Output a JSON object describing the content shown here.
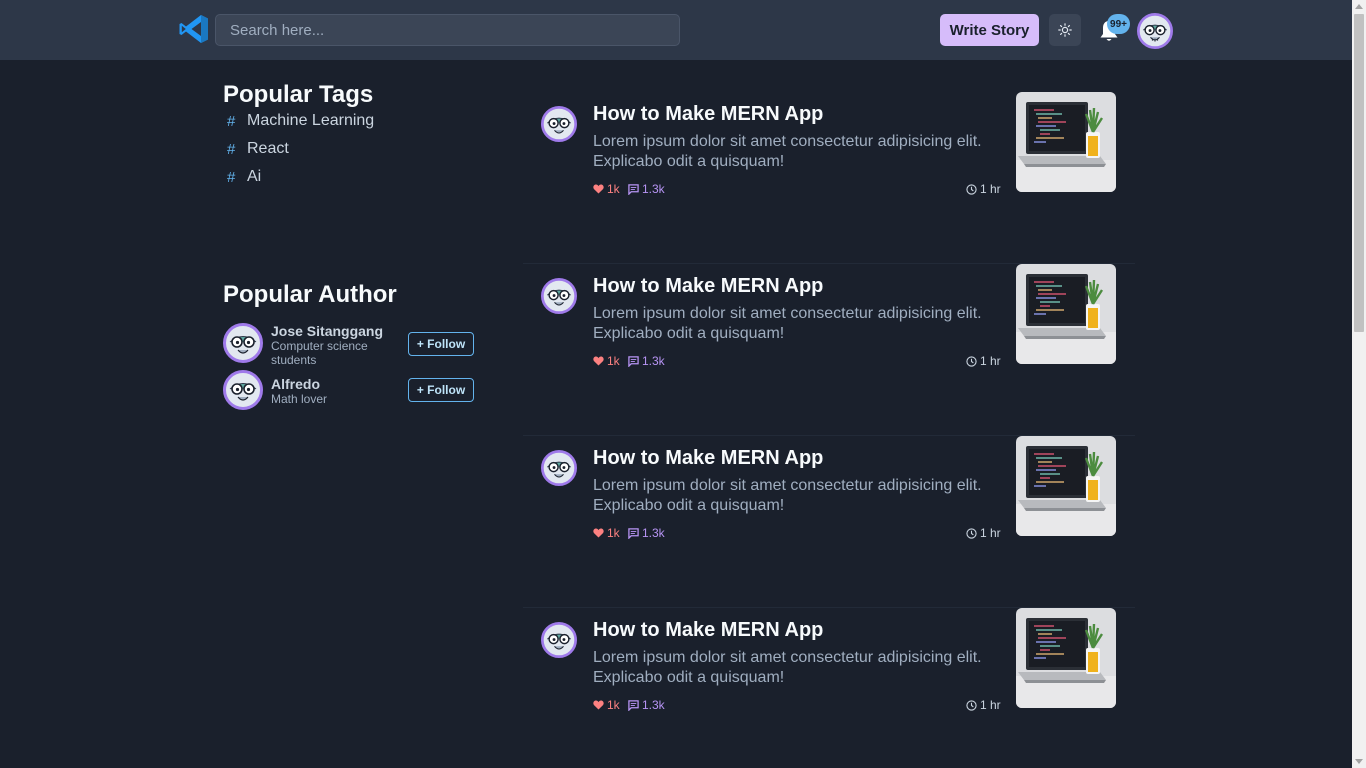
{
  "header": {
    "search_placeholder": "Search here...",
    "write_label": "Write Story",
    "notification_count": "99+",
    "colors": {
      "bg": "#2d3748",
      "accent": "#d6bcfa",
      "badge": "#63b3ed",
      "logo": "#2196f3"
    }
  },
  "sidebar": {
    "tags_title": "Popular Tags",
    "tags": [
      {
        "hash": "#",
        "label": "Machine Learning"
      },
      {
        "hash": "#",
        "label": "React"
      },
      {
        "hash": "#",
        "label": "Ai"
      }
    ],
    "authors_title": "Popular Author",
    "authors": [
      {
        "name": "Jose Sitanggang",
        "bio": "Computer science students",
        "follow_label": "+ Follow"
      },
      {
        "name": "Alfredo",
        "bio": "Math lover",
        "follow_label": "+ Follow"
      }
    ]
  },
  "posts": [
    {
      "title": "How to Make MERN App",
      "excerpt": "Lorem ipsum dolor sit amet consectetur adipisicing elit. Explicabo odit a quisquam!",
      "likes": "1k",
      "comments": "1.3k",
      "time": "1 hr"
    },
    {
      "title": "How to Make MERN App",
      "excerpt": "Lorem ipsum dolor sit amet consectetur adipisicing elit. Explicabo odit a quisquam!",
      "likes": "1k",
      "comments": "1.3k",
      "time": "1 hr"
    },
    {
      "title": "How to Make MERN App",
      "excerpt": "Lorem ipsum dolor sit amet consectetur adipisicing elit. Explicabo odit a quisquam!",
      "likes": "1k",
      "comments": "1.3k",
      "time": "1 hr"
    },
    {
      "title": "How to Make MERN App",
      "excerpt": "Lorem ipsum dolor sit amet consectetur adipisicing elit. Explicabo odit a quisquam!",
      "likes": "1k",
      "comments": "1.3k",
      "time": "1 hr"
    }
  ],
  "icons": [
    "vscode-logo-icon",
    "sun-icon",
    "bell-icon",
    "avatar",
    "heart-icon",
    "comment-icon",
    "clock-icon",
    "laptop-thumbnail"
  ]
}
